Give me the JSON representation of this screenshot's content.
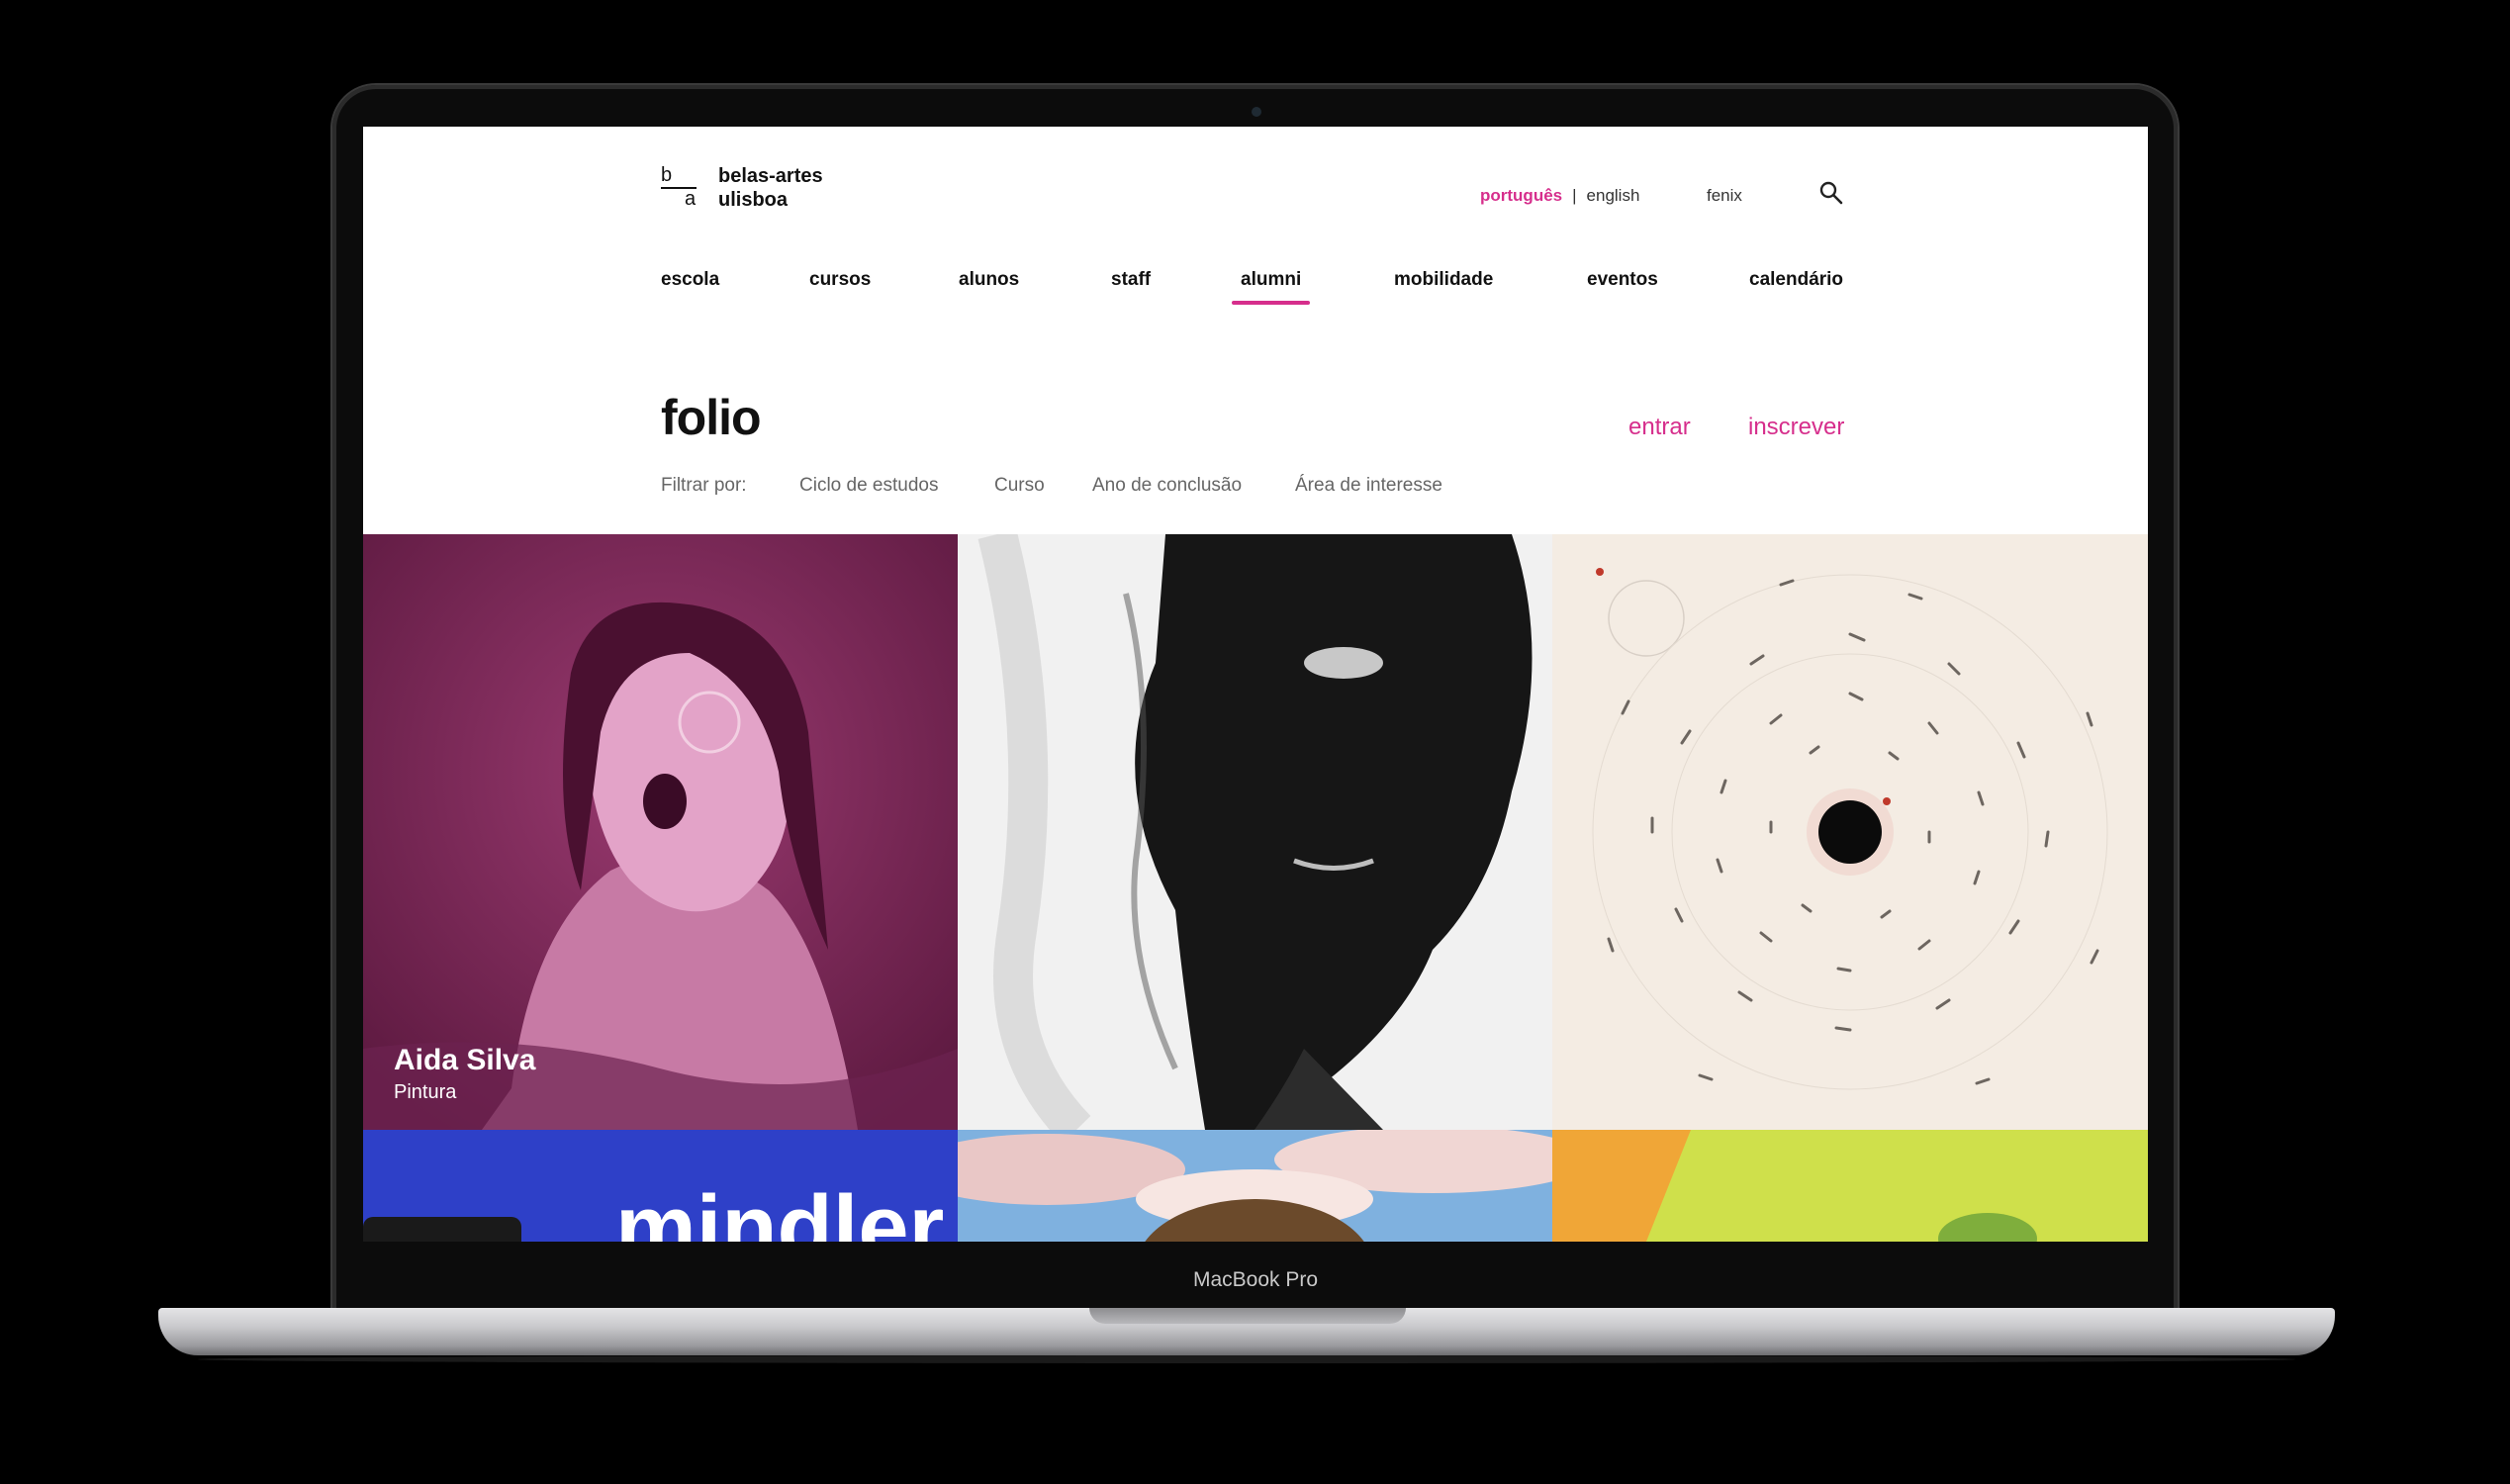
{
  "device": {
    "label": "MacBook Pro"
  },
  "header": {
    "logo": {
      "mark_b": "b",
      "mark_a": "a",
      "line1": "belas-artes",
      "line2": "ulisboa"
    },
    "languages": {
      "active": "português",
      "separator": "|",
      "other": "english"
    },
    "fenix": "fenix",
    "search_icon": "search-icon"
  },
  "nav": {
    "items": [
      "escola",
      "cursos",
      "alunos",
      "staff",
      "alumni",
      "mobilidade",
      "eventos",
      "calendário"
    ],
    "active": "alumni"
  },
  "page": {
    "title": "folio",
    "actions": {
      "login": "entrar",
      "signup": "inscrever"
    }
  },
  "filters": {
    "label": "Filtrar por:",
    "options": [
      "Ciclo de estudos",
      "Curso",
      "Ano de conclusão",
      "Área de interesse"
    ]
  },
  "gallery": {
    "tiles": [
      {
        "name": "Aida Silva",
        "course": "Pintura"
      },
      {
        "name": "",
        "course": ""
      },
      {
        "name": "",
        "course": ""
      },
      {
        "name": "",
        "course": "",
        "fragment_text": "mindler"
      },
      {
        "name": "",
        "course": ""
      },
      {
        "name": "",
        "course": ""
      }
    ]
  },
  "colors": {
    "accent": "#d62e8c",
    "text": "#111111",
    "muted": "#666666"
  }
}
